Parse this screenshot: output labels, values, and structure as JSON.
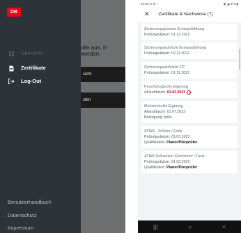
{
  "left": {
    "logo": "DB",
    "background_text": [
      "olle aus, in",
      "werden."
    ],
    "background_buttons": [
      "sicht",
      "sten"
    ],
    "nav": [
      {
        "label": "Übersicht",
        "icon": "grid-icon"
      },
      {
        "label": "Zertifikate",
        "icon": "document-icon"
      },
      {
        "label": "Log-Out",
        "icon": "logout-icon"
      }
    ],
    "footer_links": [
      "Benutzerhandbuch",
      "Datenschutz",
      "Impressum"
    ]
  },
  "right": {
    "status": {
      "time": "10:56",
      "icons_left": "✉ ⚙ •",
      "icons_right": "◉ ◢ 87%▮"
    },
    "app_bar": {
      "close_glyph": "✕",
      "title": "Zertifikate & Nachweise (7)"
    },
    "cards": [
      {
        "title": "Sicherungsposten Erstausbildung",
        "lines": [
          {
            "label": "Prüfungsdatum:",
            "value": "01.12.2022"
          }
        ]
      },
      {
        "title": "Sicherungsaufsicht Erstausbildung",
        "lines": [
          {
            "label": "Prüfungsdatum:",
            "value": "02.11.2022"
          }
        ]
      },
      {
        "title": "Sicherungsaufsicht FIT",
        "lines": [
          {
            "label": "Prüfungsdatum:",
            "value": "01.11.2022"
          }
        ]
      },
      {
        "title": "Psychologische Eignung",
        "lines": [
          {
            "label": "Ablaufdatum:",
            "value": "01.02.2023"
          }
        ]
      },
      {
        "title": "Medizinische Eignung",
        "lines": [
          {
            "label": "Ablaufdatum:",
            "value": "01.07.2023"
          },
          {
            "label": "Bedingung:",
            "value": "brille"
          }
        ]
      },
      {
        "title": "ATWS - Zöllner / Funk",
        "lines": [
          {
            "label": "Prüfungsdatum:",
            "value": "01.03.2023"
          },
          {
            "label": "Qualifikation:",
            "value": "Planer/Planprüfer"
          }
        ]
      },
      {
        "title": "ATWS Schweizer Electronic / Funk",
        "lines": [
          {
            "label": "Prüfungsdatum:",
            "value": "01.03.2023"
          },
          {
            "label": "Qualifikation:",
            "value": "Planer/Planprüfer"
          }
        ]
      }
    ],
    "navbar": [
      "|||",
      "○",
      "<"
    ]
  },
  "colors": {
    "db_red": "#ec0016",
    "drawer": "#2d3339",
    "warning": "#c8001e"
  }
}
